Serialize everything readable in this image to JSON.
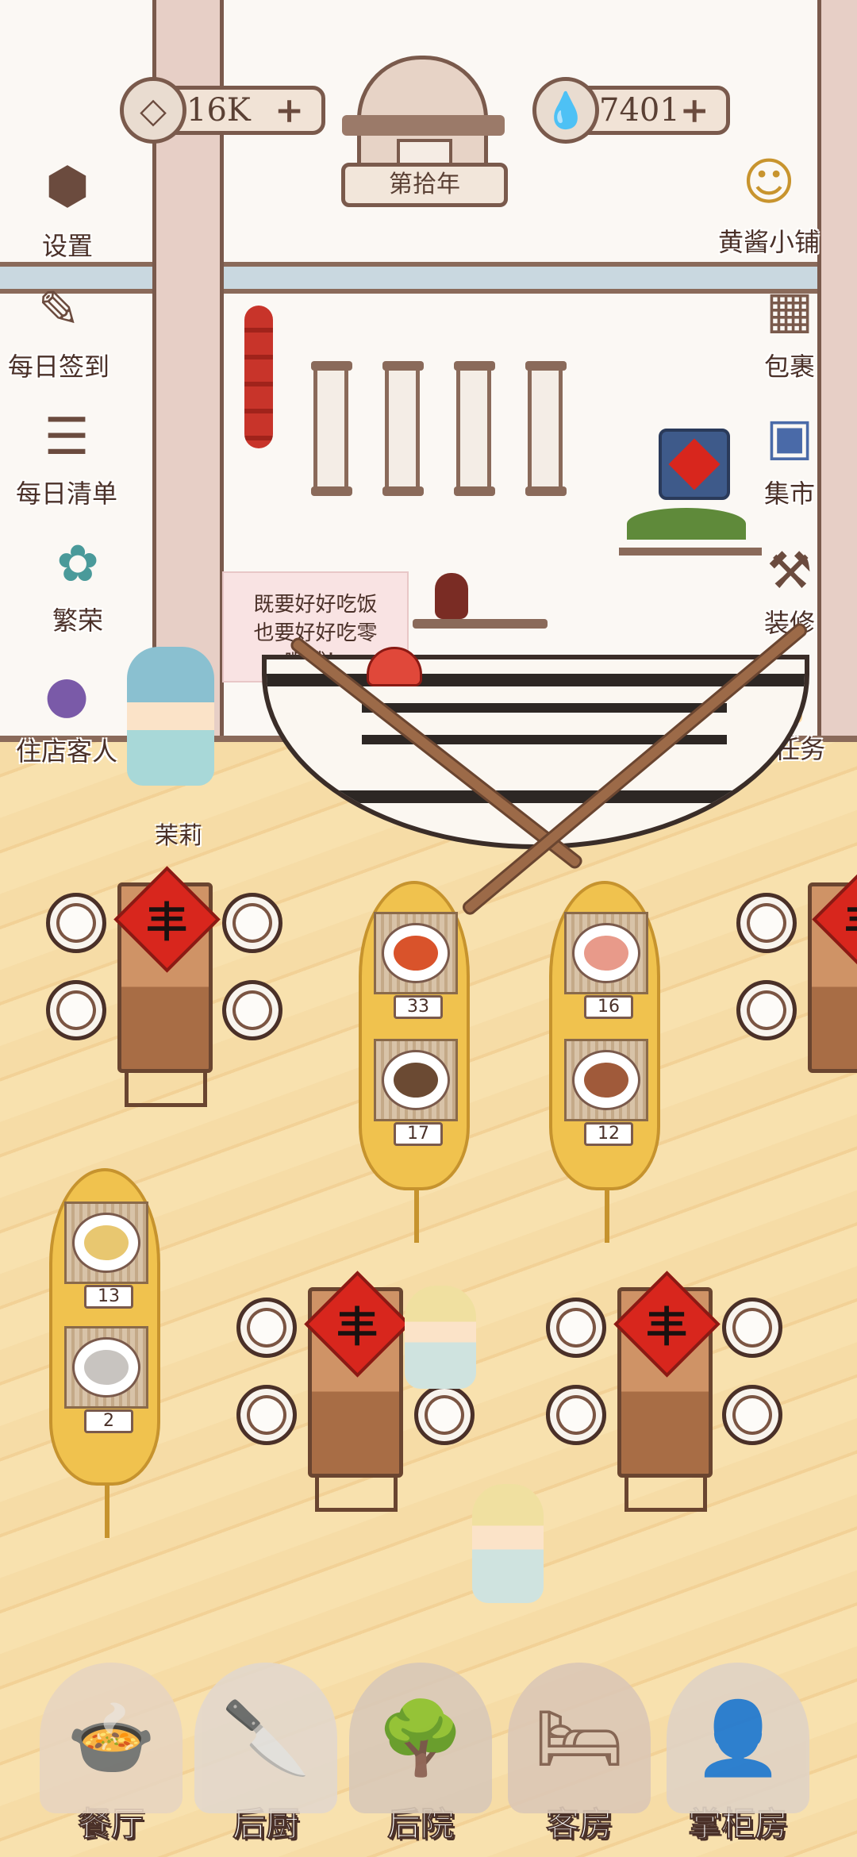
{
  "header": {
    "coins": {
      "value": "16K",
      "icon": "coin-icon"
    },
    "year_label": "第拾年",
    "water": {
      "value": "7401",
      "icon": "water-drop-icon"
    }
  },
  "left_menu": [
    {
      "label": "设置",
      "icon": "settings-icon"
    },
    {
      "label": "每日签到",
      "icon": "daily-checkin-icon"
    },
    {
      "label": "每日清单",
      "icon": "daily-list-icon"
    },
    {
      "label": "繁荣",
      "icon": "prosperity-icon"
    },
    {
      "label": "住店客人",
      "icon": "guests-icon"
    }
  ],
  "right_menu": [
    {
      "label": "黄酱小铺",
      "icon": "shop-icon"
    },
    {
      "label": "包裹",
      "icon": "package-icon"
    },
    {
      "label": "集市",
      "icon": "market-icon"
    },
    {
      "label": "装修",
      "icon": "decorate-icon"
    },
    {
      "label": "新手任务",
      "icon": "beginner-tasks-icon"
    }
  ],
  "wall_note": {
    "line1": "既要好好吃饭",
    "line2": "也要好好吃零",
    "line3": "嘴哦！"
  },
  "characters": {
    "guide_name": "茉莉"
  },
  "table_char": "丰",
  "dishes": [
    {
      "count": "33",
      "color": "#d9532b"
    },
    {
      "count": "16",
      "color": "#e89a8a"
    },
    {
      "count": "17",
      "color": "#6b4a33"
    },
    {
      "count": "12",
      "color": "#a05a3a"
    },
    {
      "count": "13",
      "color": "#e8c770"
    },
    {
      "count": "2",
      "color": "#c8c4c0"
    }
  ],
  "bottom_nav": [
    {
      "label": "餐厅",
      "icon": "restaurant-icon"
    },
    {
      "label": "后厨",
      "icon": "kitchen-icon"
    },
    {
      "label": "后院",
      "icon": "backyard-icon"
    },
    {
      "label": "客房",
      "icon": "guest-room-icon"
    },
    {
      "label": "掌柜房",
      "icon": "manager-room-icon"
    }
  ]
}
